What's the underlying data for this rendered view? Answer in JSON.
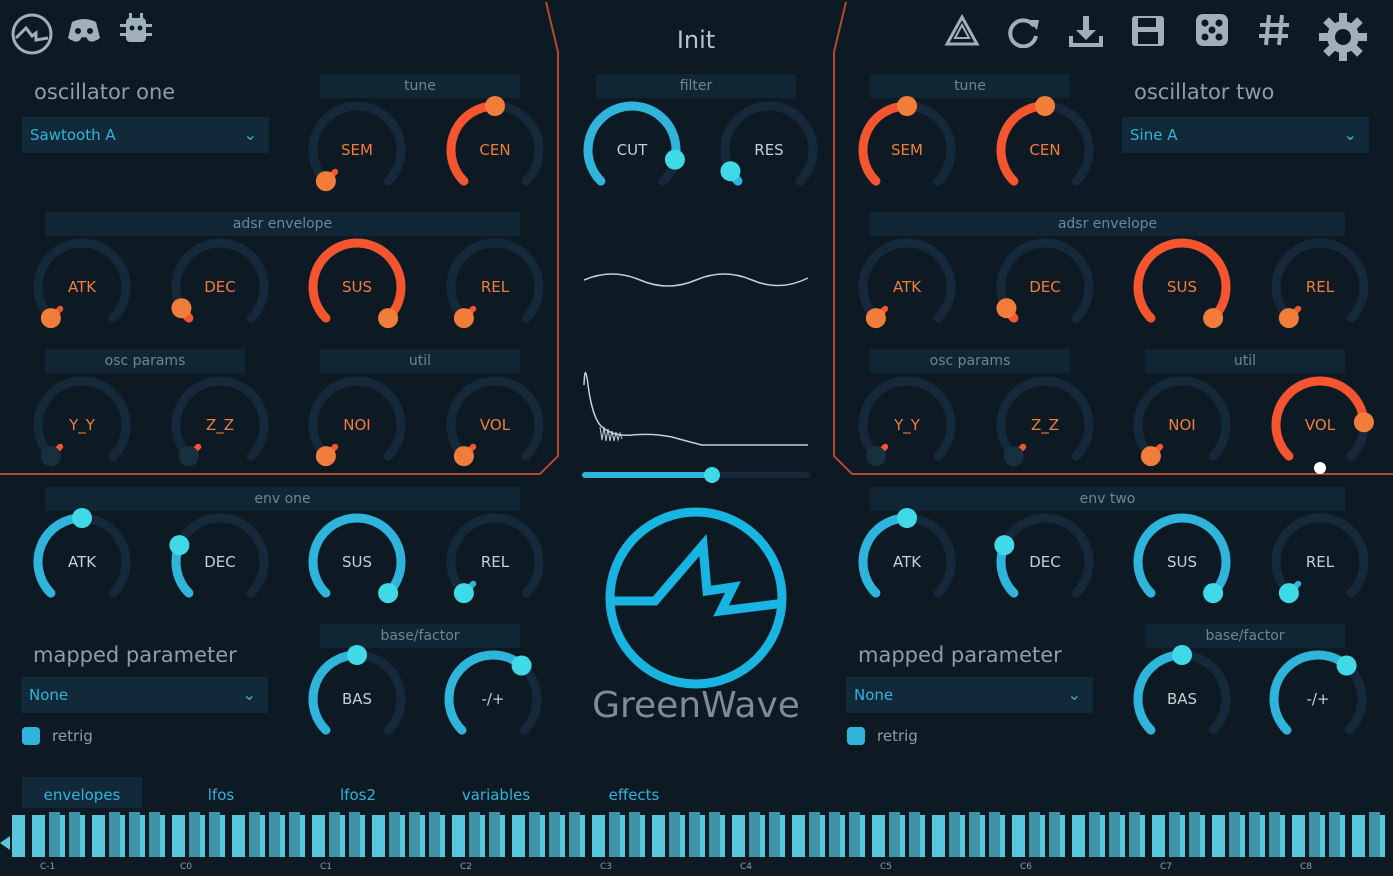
{
  "toolbar_left": {
    "icons": [
      "logo-icon",
      "discord-icon",
      "bug-icon"
    ]
  },
  "toolbar_right": {
    "icons": [
      "recycle-icon",
      "reload-icon",
      "download-icon",
      "save-icon",
      "dice-icon",
      "hash-icon",
      "gear-icon"
    ]
  },
  "preset": {
    "name": "Init"
  },
  "osc_one": {
    "heading": "oscillator one",
    "waveform": "Sawtooth A",
    "tune_label": "tune",
    "adsr_label": "adsr envelope",
    "params_label": "osc params",
    "util_label": "util",
    "knobs": {
      "sem": "SEM",
      "cen": "CEN",
      "atk": "ATK",
      "dec": "DEC",
      "sus": "SUS",
      "rel": "REL",
      "yy": "Y_Y",
      "zz": "Z_Z",
      "noi": "NOI",
      "vol": "VOL"
    }
  },
  "osc_two": {
    "heading": "oscillator two",
    "waveform": "Sine A",
    "tune_label": "tune",
    "adsr_label": "adsr envelope",
    "params_label": "osc params",
    "util_label": "util",
    "knobs": {
      "sem": "SEM",
      "cen": "CEN",
      "atk": "ATK",
      "dec": "DEC",
      "sus": "SUS",
      "rel": "REL",
      "yy": "Y_Y",
      "zz": "Z_Z",
      "noi": "NOI",
      "vol": "VOL"
    }
  },
  "filter": {
    "label": "filter",
    "cut": "CUT",
    "res": "RES",
    "slider_value": 0.57
  },
  "env_one": {
    "label": "env one",
    "atk": "ATK",
    "dec": "DEC",
    "sus": "SUS",
    "rel": "REL",
    "mapped_heading": "mapped parameter",
    "mapped_value": "None",
    "retrig": "retrig",
    "base_label": "base/factor",
    "bas": "BAS",
    "factor": "-/+"
  },
  "env_two": {
    "label": "env two",
    "atk": "ATK",
    "dec": "DEC",
    "sus": "SUS",
    "rel": "REL",
    "mapped_heading": "mapped parameter",
    "mapped_value": "None",
    "retrig": "retrig",
    "base_label": "base/factor",
    "bas": "BAS",
    "factor": "-/+"
  },
  "brand": {
    "name": "GreenWave"
  },
  "tabs": [
    {
      "label": "envelopes",
      "active": true
    },
    {
      "label": "lfos",
      "active": false
    },
    {
      "label": "lfos2",
      "active": false
    },
    {
      "label": "variables",
      "active": false
    },
    {
      "label": "effects",
      "active": false
    }
  ],
  "keyboard": {
    "octaves": [
      "C-1",
      "C0",
      "C1",
      "C2",
      "C3",
      "C4",
      "C5",
      "C6",
      "C7",
      "C8"
    ]
  },
  "colors": {
    "background": "#0d1a24",
    "orange": "#f4552e",
    "orange_light": "#f27d3b",
    "cyan": "#2fb4dc",
    "cyan_light": "#3fd9e8",
    "track": "#15293a",
    "border": "#b4472e"
  }
}
